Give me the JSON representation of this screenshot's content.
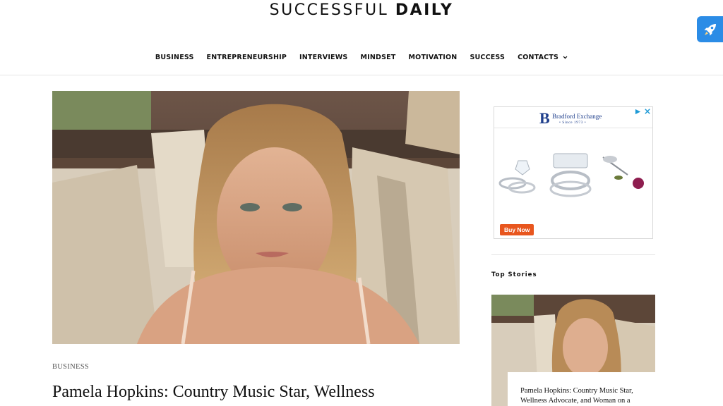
{
  "site": {
    "logo_light": "SUCCESSFUL",
    "logo_bold": "DAILY"
  },
  "nav": {
    "items": [
      "BUSINESS",
      "ENTREPRENEURSHIP",
      "INTERVIEWS",
      "MINDSET",
      "MOTIVATION",
      "SUCCESS",
      "CONTACTS"
    ]
  },
  "article": {
    "category": "BUSINESS",
    "headline": "Pamela Hopkins: Country Music Star, Wellness"
  },
  "ad": {
    "brand_initial": "B",
    "brand_name": "Bradford Exchange",
    "brand_since": "• Since 1973 •",
    "cta": "Buy Now"
  },
  "sidebar": {
    "section_title": "Top Stories",
    "story_title": "Pamela Hopkins: Country Music Star, Wellness Advocate, and Woman on a"
  },
  "colors": {
    "accent_blue": "#2b8ce6",
    "ad_cta": "#e8561e",
    "ad_brand": "#1f3f8c"
  }
}
